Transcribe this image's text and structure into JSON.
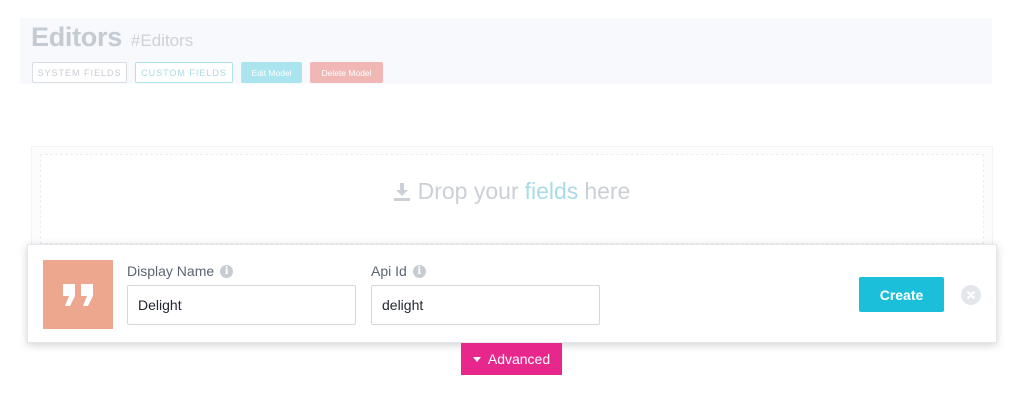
{
  "header": {
    "title": "Editors",
    "model_id": "#Editors",
    "buttons": {
      "system_fields": "SYSTEM FIELDS",
      "custom_fields": "CUSTOM FIELDS",
      "edit_model": "Edit Model",
      "delete_model": "Delete Model"
    }
  },
  "dropzone": {
    "prefix": "Drop your",
    "highlight": "fields",
    "suffix": "here",
    "icon": "download-icon"
  },
  "field_card": {
    "icon": "quote-icon",
    "icon_color": "#eca78e",
    "display_name": {
      "label": "Display Name",
      "value": "Delight"
    },
    "api_id": {
      "label": "Api Id",
      "value": "delight"
    },
    "create_label": "Create",
    "create_color": "#1bbfd9"
  },
  "advanced": {
    "label": "Advanced",
    "color": "#e8278c"
  }
}
